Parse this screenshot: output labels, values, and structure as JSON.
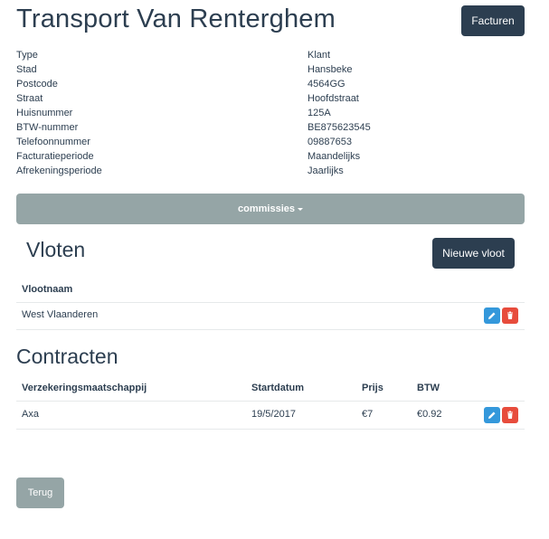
{
  "page": {
    "title": "Transport Van Renterghem",
    "facturen_label": "Facturen"
  },
  "info": {
    "rows": [
      {
        "label": "Type",
        "value": "Klant"
      },
      {
        "label": "Stad",
        "value": "Hansbeke"
      },
      {
        "label": "Postcode",
        "value": "4564GG"
      },
      {
        "label": "Straat",
        "value": "Hoofdstraat"
      },
      {
        "label": "Huisnummer",
        "value": "125A"
      },
      {
        "label": "BTW-nummer",
        "value": "BE875623545"
      },
      {
        "label": "Telefoonnummer",
        "value": "09887653"
      },
      {
        "label": "Facturatieperiode",
        "value": "Maandelijks"
      },
      {
        "label": "Afrekeningsperiode",
        "value": "Jaarlijks"
      }
    ]
  },
  "commissies": {
    "label": "commissies"
  },
  "vloten": {
    "title": "Vloten",
    "new_label": "Nieuwe vloot",
    "header": "Vlootnaam",
    "rows": [
      {
        "name": "West Vlaanderen"
      }
    ]
  },
  "contracten": {
    "title": "Contracten",
    "headers": {
      "company": "Verzekeringsmaatschappij",
      "start": "Startdatum",
      "price": "Prijs",
      "vat": "BTW"
    },
    "rows": [
      {
        "company": "Axa",
        "start": "19/5/2017",
        "price": "€7",
        "vat": "€0.92"
      }
    ]
  },
  "footer": {
    "back_label": "Terug"
  },
  "colors": {
    "primary_dark": "#2c3e50",
    "gray": "#95a5a6",
    "edit_blue": "#3498db",
    "delete_red": "#e74c3c"
  },
  "icons": {
    "edit": "pencil-icon",
    "delete": "trash-icon",
    "dropdown": "caret-down-icon"
  }
}
